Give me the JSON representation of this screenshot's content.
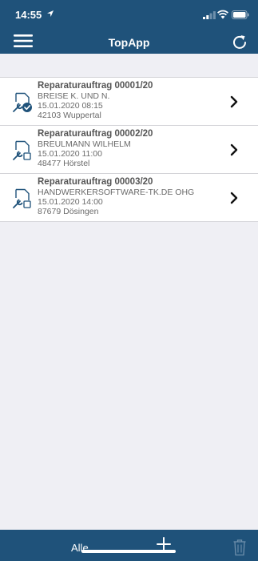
{
  "status_bar": {
    "time": "14:55"
  },
  "header": {
    "title": "TopApp"
  },
  "orders": [
    {
      "title": "Reparaturauftrag 00001/20",
      "customer": "BREISE K. UND N.",
      "date": "15.01.2020 08:15",
      "location": "42103 Wuppertal",
      "status": "done"
    },
    {
      "title": "Reparaturauftrag 00002/20",
      "customer": "BREULMANN WILHELM",
      "date": "15.01.2020 11:00",
      "location": "48477 Hörstel",
      "status": "open"
    },
    {
      "title": "Reparaturauftrag 00003/20",
      "customer": "HANDWERKERSOFTWARE-TK.DE OHG",
      "date": "15.01.2020 14:00",
      "location": "87679 Dösingen",
      "status": "open"
    }
  ],
  "bottom_bar": {
    "filter_label": "Alle"
  },
  "colors": {
    "bar": "#1f527a",
    "background": "#efeff4",
    "icon": "#1f527a"
  }
}
